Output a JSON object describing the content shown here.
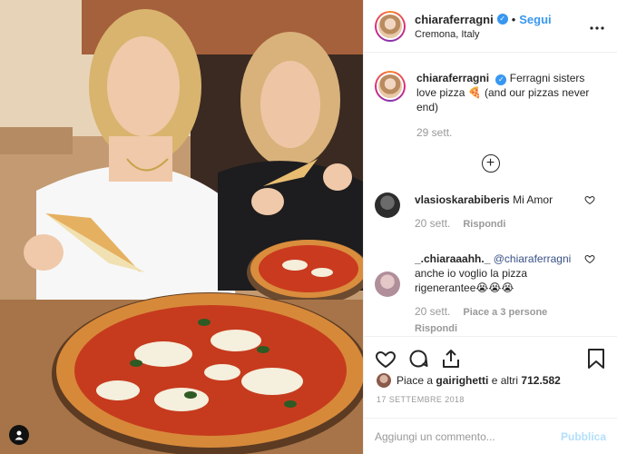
{
  "post": {
    "author": "chiaraferragni",
    "follow_label": "Segui",
    "separator": "•",
    "location": "Cremona, Italy",
    "more_label": "•••"
  },
  "caption": {
    "author": "chiaraferragni",
    "text": "Ferragni sisters love pizza 🍕 (and our pizzas never end)",
    "time": "29 sett."
  },
  "load_more_label": "+",
  "comments": [
    {
      "author": "vlasioskarabiberis",
      "text": "Mi Amor",
      "time": "20 sett.",
      "reply_label": "Rispondi"
    },
    {
      "author": "_.chiaraaahh._",
      "mention": "@chiaraferragni",
      "text": "anche io voglio la pizza rigenerantee😭😭😭",
      "time": "20 sett.",
      "likes_label": "Piace a 3 persone",
      "reply_label": "Rispondi"
    }
  ],
  "likes": {
    "prefix": "Piace a",
    "user": "gairighetti",
    "suffix": "e altri",
    "count": "712.582"
  },
  "date": "17 SETTEMBRE 2018",
  "add_comment": {
    "placeholder": "Aggiungi un commento...",
    "publish_label": "Pubblica"
  },
  "colors": {
    "accent": "#3897f0",
    "publish_disabled": "#b2dffc",
    "muted": "#999999",
    "text": "#262626"
  },
  "icons": [
    "heart-icon",
    "comment-icon",
    "share-icon",
    "bookmark-icon",
    "user-tag-icon",
    "plus-circle-icon",
    "verified-badge-icon"
  ]
}
